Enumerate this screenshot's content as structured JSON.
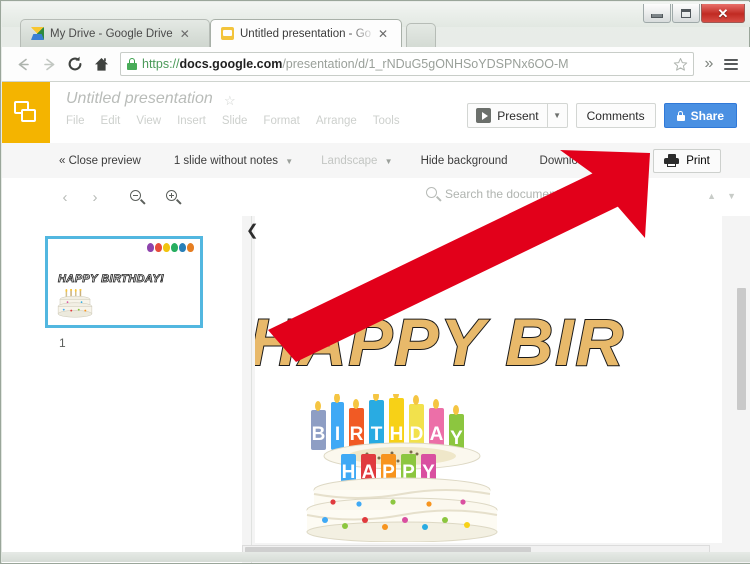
{
  "window": {
    "controls": {
      "minimize": "minimize-button",
      "maximize": "maximize-button",
      "close_label": "✕"
    }
  },
  "browser": {
    "tabs": [
      {
        "title": "My Drive - Google Drive",
        "favicon": "google-drive-icon",
        "active": false,
        "close_label": "✕"
      },
      {
        "title": "Untitled presentation - Go",
        "favicon": "google-slides-icon",
        "active": true,
        "close_label": "✕"
      }
    ],
    "nav": {
      "back": "←",
      "forward": "→",
      "reload": "⟳",
      "home": "⌂"
    },
    "omnibox": {
      "scheme": "https://",
      "host": "docs.google.com",
      "path": "/presentation/d/1_rNDuG5gONHSoYDSPNx6OO-M",
      "full_url": "https://docs.google.com/presentation/d/1_rNDuG5gONHSoYDSPNx6OO-M",
      "secure": true,
      "star_label": "☆",
      "overflow_label": "»"
    }
  },
  "slides_header": {
    "title": "Untitled presentation",
    "star_label": "☆",
    "menus": [
      "File",
      "Edit",
      "View",
      "Insert",
      "Slide",
      "Format",
      "Arrange",
      "Tools"
    ],
    "present_label": "Present",
    "present_caret": "▼",
    "comments_label": "Comments",
    "share_label": "Share"
  },
  "preview_toolbar": {
    "close_preview": "« Close preview",
    "notes_option": "1 slide without notes",
    "notes_caret": "▼",
    "orientation": "Landscape",
    "orientation_caret": "▼",
    "hide_background": "Hide background",
    "download_pdf": "Download as PDF",
    "print_label": "Print"
  },
  "search_bar": {
    "prev_page": "‹",
    "next_page": "›",
    "zoom_out": "zoom-out-icon",
    "zoom_in": "zoom-in-icon",
    "search_placeholder": "Search the document",
    "find_up": "▲",
    "find_down": "▼"
  },
  "filmstrip": {
    "slides": [
      {
        "number": "1",
        "title": "HAPPY BIRTHDAY!",
        "balloon_colors": [
          "#8e44ad",
          "#e74c3c",
          "#f1c40f",
          "#27ae60",
          "#2980b9",
          "#e67e22"
        ]
      }
    ]
  },
  "preview": {
    "collapse_chevron": "❮",
    "slide_title_visible": "HAPPY BIR",
    "cake_top_word": "BIRTHDAY",
    "cake_bottom_word": "HAPPY",
    "cake_top_letters": [
      "B",
      "I",
      "R",
      "T",
      "H",
      "D",
      "A",
      "Y"
    ],
    "cake_bottom_letters": [
      "H",
      "A",
      "P",
      "P",
      "Y"
    ],
    "cake_top_colors": [
      "#8e9ec4",
      "#3fa9f5",
      "#f15a24",
      "#29abe2",
      "#f7d117",
      "#f2e14c",
      "#ec6fa8",
      "#8cc63f"
    ],
    "cake_bottom_colors": [
      "#3fa9f5",
      "#e03a3e",
      "#f7941e",
      "#8cc63f",
      "#d94fa0"
    ],
    "title_fill": "#e8b96a",
    "title_stroke": "#1a1a1a"
  },
  "annotation": {
    "arrow_color": "#e2001a",
    "points_to": "print-button"
  }
}
